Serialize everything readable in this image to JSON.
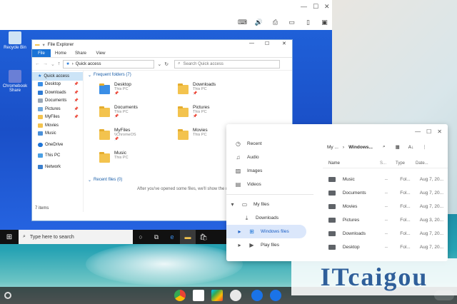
{
  "colors": {
    "win_blue": "#1a4fc7",
    "accent": "#1a73d6",
    "chrome_selected": "#dbe7fb"
  },
  "vm_window": {
    "toolbar_icons": [
      "keyboard-icon",
      "volume-icon",
      "print-icon",
      "folder-icon",
      "share-icon",
      "fullscreen-icon"
    ]
  },
  "windows_desktop": {
    "icons": [
      {
        "label": "Recycle Bin"
      },
      {
        "label": "Chromebook Share"
      }
    ],
    "taskbar": {
      "search_placeholder": "Type here to search"
    }
  },
  "file_explorer": {
    "title": "File Explorer",
    "ribbon_tabs": [
      "File",
      "Home",
      "Share",
      "View"
    ],
    "address": "Quick access",
    "search_placeholder": "Search Quick access",
    "nav": [
      {
        "label": "Quick access",
        "pinned": false,
        "selected": true
      },
      {
        "label": "Desktop",
        "pinned": true
      },
      {
        "label": "Downloads",
        "pinned": true
      },
      {
        "label": "Documents",
        "pinned": true
      },
      {
        "label": "Pictures",
        "pinned": true
      },
      {
        "label": "MyFiles",
        "pinned": true
      },
      {
        "label": "Movies",
        "pinned": false
      },
      {
        "label": "Music",
        "pinned": false
      },
      {
        "label": "OneDrive",
        "pinned": false
      },
      {
        "label": "This PC",
        "pinned": false
      },
      {
        "label": "Network",
        "pinned": false
      }
    ],
    "frequent_header": "Frequent folders (7)",
    "folders": [
      {
        "name": "Desktop",
        "location": "This PC",
        "pin": "📌"
      },
      {
        "name": "Downloads",
        "location": "This PC",
        "pin": "📌"
      },
      {
        "name": "Documents",
        "location": "This PC",
        "pin": "📌"
      },
      {
        "name": "Pictures",
        "location": "This PC",
        "pin": "📌"
      },
      {
        "name": "MyFiles",
        "location": "\\\\ChromeOS",
        "pin": "📌"
      },
      {
        "name": "Movies",
        "location": "This PC",
        "pin": ""
      },
      {
        "name": "Music",
        "location": "This PC",
        "pin": ""
      }
    ],
    "recent_header": "Recent files (0)",
    "recent_note": "After you've opened some files, we'll show the most rec",
    "status": "7 items"
  },
  "chrome_files": {
    "sidebar": [
      {
        "label": "Recent",
        "icon": "clock-icon"
      },
      {
        "label": "Audio",
        "icon": "headphones-icon"
      },
      {
        "label": "Images",
        "icon": "image-icon"
      },
      {
        "label": "Videos",
        "icon": "video-icon"
      },
      {
        "label": "My files",
        "icon": "laptop-icon"
      },
      {
        "label": "Downloads",
        "icon": "download-icon"
      },
      {
        "label": "Windows files",
        "icon": "windows-icon",
        "selected": true
      },
      {
        "label": "Play files",
        "icon": "play-icon"
      }
    ],
    "breadcrumb": {
      "parent": "My ...",
      "current": "Windows..."
    },
    "columns": {
      "name": "Name",
      "size": "S...",
      "type": "Type",
      "date": "Date..."
    },
    "rows": [
      {
        "name": "Music",
        "size": "--",
        "type": "Fol...",
        "date": "Aug 7, 20..."
      },
      {
        "name": "Documents",
        "size": "--",
        "type": "Fol...",
        "date": "Aug 7, 20..."
      },
      {
        "name": "Movies",
        "size": "--",
        "type": "Fol...",
        "date": "Aug 7, 20..."
      },
      {
        "name": "Pictures",
        "size": "--",
        "type": "Fol...",
        "date": "Aug 3, 20..."
      },
      {
        "name": "Downloads",
        "size": "--",
        "type": "Fol...",
        "date": "Aug 7, 20..."
      },
      {
        "name": "Desktop",
        "size": "--",
        "type": "Fol...",
        "date": "Aug 7, 20..."
      }
    ]
  },
  "shelf": {
    "apps": [
      "chrome-icon",
      "gmail-icon",
      "play-store-icon",
      "camera-icon",
      "settings-icon",
      "files-icon"
    ]
  },
  "watermark": "ITcaigou"
}
